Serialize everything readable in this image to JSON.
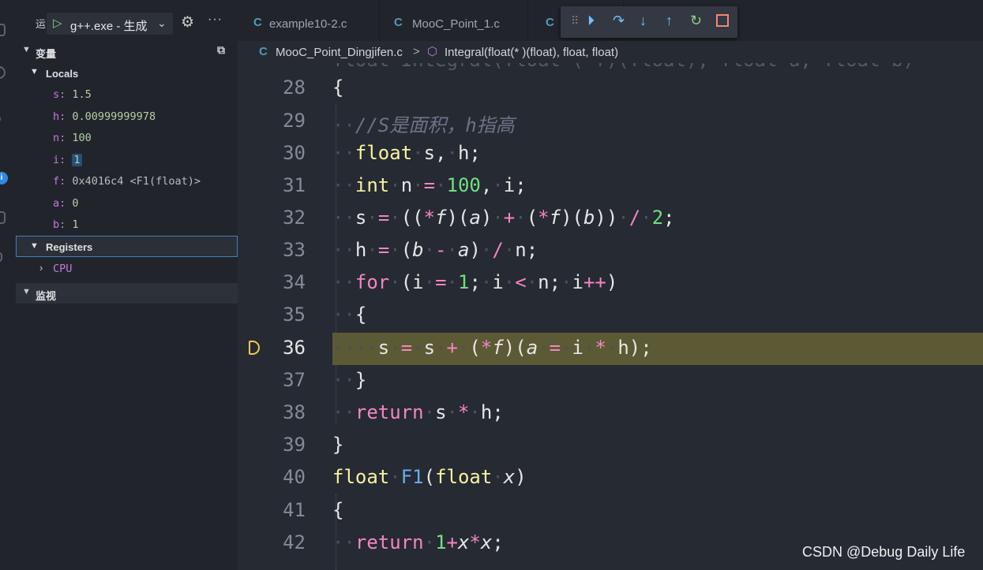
{
  "run_panel": {
    "title": "运",
    "config": "g++.exe - 生成",
    "more": "···"
  },
  "tabs": [
    {
      "label": "example10-2.c"
    },
    {
      "label": "MooC_Point_1.c"
    },
    {
      "label": ""
    }
  ],
  "breadcrumb": {
    "file": "MooC_Point_Dingjifen.c",
    "separator": ">",
    "symbol": "Integral(float(* )(float), float, float)"
  },
  "variables": {
    "section": "变量",
    "locals_label": "Locals",
    "items": [
      {
        "name": "s:",
        "value": "1.5"
      },
      {
        "name": "h:",
        "value": "0.00999999978"
      },
      {
        "name": "n:",
        "value": "100"
      },
      {
        "name": "i:",
        "value": "1"
      },
      {
        "name": "f:",
        "value": "0x4016c4 <F1(float)>"
      },
      {
        "name": "a:",
        "value": "0"
      },
      {
        "name": "b:",
        "value": "1"
      }
    ],
    "registers_label": "Registers",
    "cpu_label": "CPU"
  },
  "watch": {
    "section": "监视"
  },
  "editor": {
    "current_line": 36,
    "line_numbers": [
      "28",
      "29",
      "30",
      "31",
      "32",
      "33",
      "34",
      "35",
      "36",
      "37",
      "38",
      "39",
      "40",
      "41",
      "42"
    ],
    "comment": "//S是面积，h指高"
  },
  "watermark": "CSDN @Debug Daily Life",
  "colors": {
    "current_line_bg": "#5c5a34",
    "accent": "#3f7fbf",
    "breakpoint": "#f2c94c"
  }
}
